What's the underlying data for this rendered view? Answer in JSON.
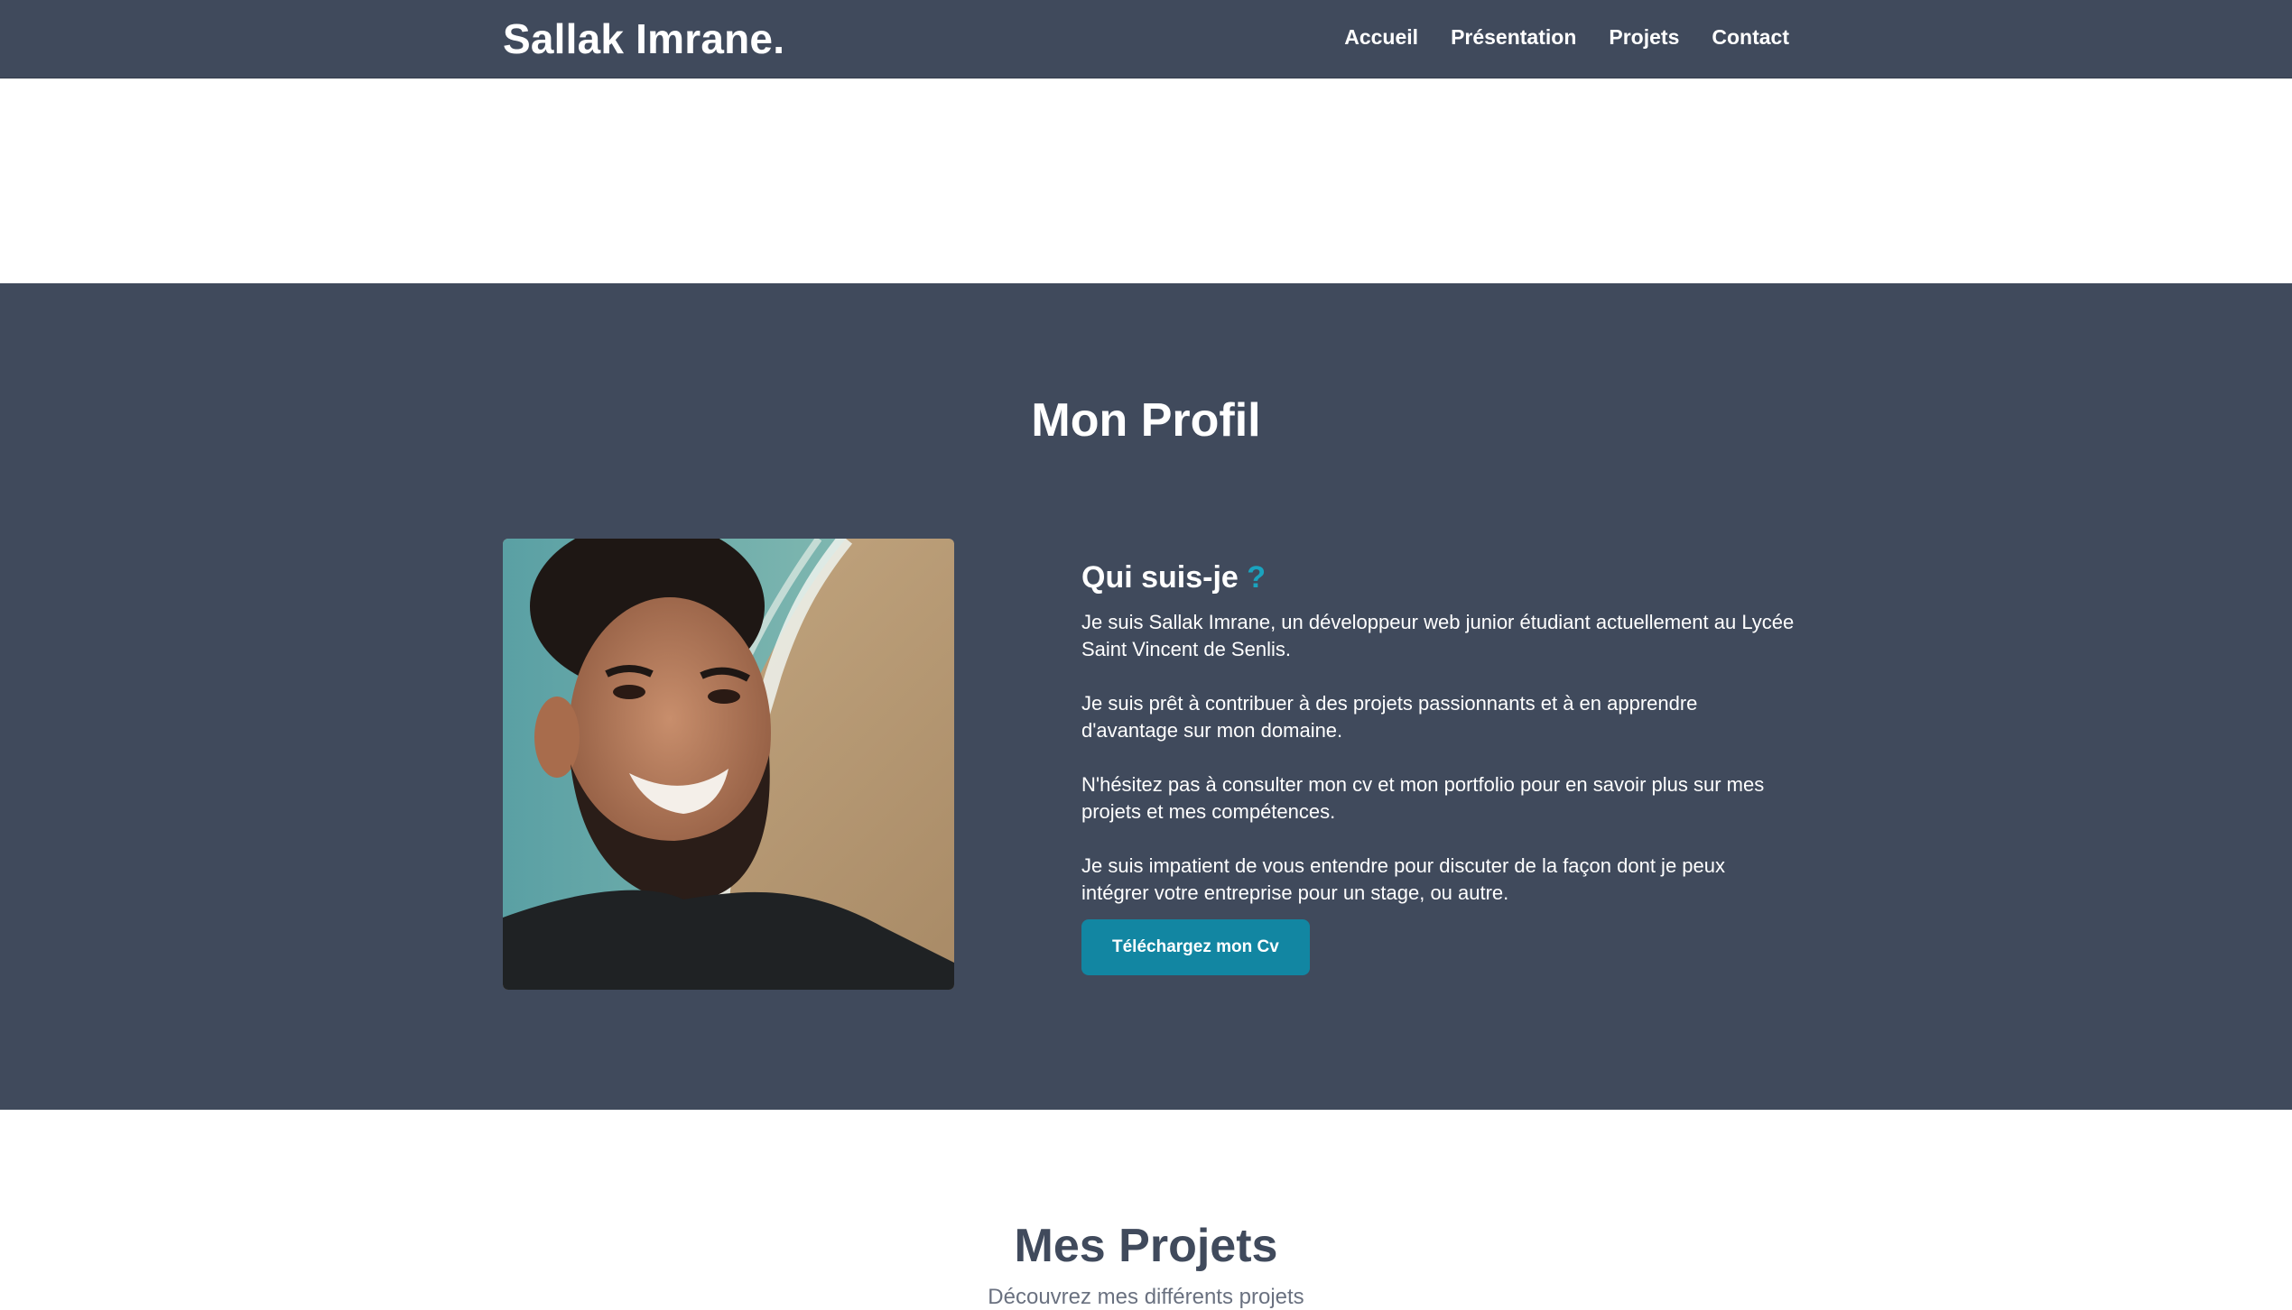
{
  "header": {
    "brand": "Sallak Imrane.",
    "nav": [
      {
        "label": "Accueil"
      },
      {
        "label": "Présentation"
      },
      {
        "label": "Projets"
      },
      {
        "label": "Contact"
      }
    ]
  },
  "profile": {
    "title": "Mon Profil",
    "heading": "Qui suis-je",
    "heading_mark": "?",
    "paragraphs": [
      "Je suis Sallak Imrane, un développeur web junior étudiant actuellement au Lycée Saint Vincent de Senlis.",
      "Je suis prêt à contribuer à des projets passionnants et à en apprendre d'avantage sur mon domaine.",
      "N'hésitez pas à consulter mon cv et mon portfolio pour en savoir plus sur mes projets et mes compétences.",
      "Je suis impatient de vous entendre pour discuter de la façon dont je peux intégrer votre entreprise pour un stage, ou autre."
    ],
    "cv_button": "Téléchargez mon Cv"
  },
  "projects": {
    "title": "Mes Projets",
    "subtitle": "Découvrez mes différents projets"
  },
  "colors": {
    "nav_bg": "#404a5c",
    "accent": "#1286a2",
    "question_mark": "#1aa3be"
  }
}
